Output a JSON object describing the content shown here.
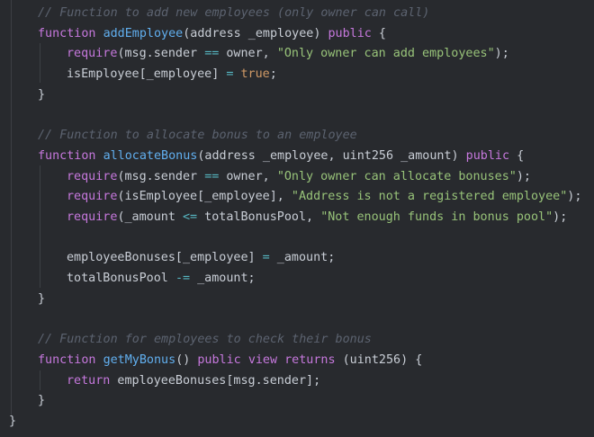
{
  "theme": {
    "background": "#282a2e",
    "text": "#c9ced6",
    "keyword": "#c678dd",
    "function": "#61afef",
    "string": "#98c379",
    "comment": "#5c6370",
    "boolean": "#d19a66",
    "operator": "#56b6c2"
  },
  "code": {
    "lines": [
      [
        {
          "t": "comment",
          "v": "// Function to add new employees (only owner can call)"
        }
      ],
      [
        {
          "t": "keyword",
          "v": "function"
        },
        {
          "t": "ident",
          "v": " "
        },
        {
          "t": "func",
          "v": "addEmployee"
        },
        {
          "t": "ident",
          "v": "(address _employee) "
        },
        {
          "t": "keyword",
          "v": "public"
        },
        {
          "t": "ident",
          "v": " {"
        }
      ],
      [
        {
          "t": "keyword",
          "v": "require"
        },
        {
          "t": "ident",
          "v": "(msg.sender "
        },
        {
          "t": "op",
          "v": "=="
        },
        {
          "t": "ident",
          "v": " owner, "
        },
        {
          "t": "string",
          "v": "\"Only owner can add employees\""
        },
        {
          "t": "ident",
          "v": ");"
        }
      ],
      [
        {
          "t": "ident",
          "v": "isEmployee[_employee] "
        },
        {
          "t": "op",
          "v": "="
        },
        {
          "t": "ident",
          "v": " "
        },
        {
          "t": "bool",
          "v": "true"
        },
        {
          "t": "ident",
          "v": ";"
        }
      ],
      [
        {
          "t": "ident",
          "v": "}"
        }
      ],
      [],
      [
        {
          "t": "comment",
          "v": "// Function to allocate bonus to an employee"
        }
      ],
      [
        {
          "t": "keyword",
          "v": "function"
        },
        {
          "t": "ident",
          "v": " "
        },
        {
          "t": "func",
          "v": "allocateBonus"
        },
        {
          "t": "ident",
          "v": "(address _employee, uint256 _amount) "
        },
        {
          "t": "keyword",
          "v": "public"
        },
        {
          "t": "ident",
          "v": " {"
        }
      ],
      [
        {
          "t": "keyword",
          "v": "require"
        },
        {
          "t": "ident",
          "v": "(msg.sender "
        },
        {
          "t": "op",
          "v": "=="
        },
        {
          "t": "ident",
          "v": " owner, "
        },
        {
          "t": "string",
          "v": "\"Only owner can allocate bonuses\""
        },
        {
          "t": "ident",
          "v": ");"
        }
      ],
      [
        {
          "t": "keyword",
          "v": "require"
        },
        {
          "t": "ident",
          "v": "(isEmployee[_employee], "
        },
        {
          "t": "string",
          "v": "\"Address is not a registered employee\""
        },
        {
          "t": "ident",
          "v": ");"
        }
      ],
      [
        {
          "t": "keyword",
          "v": "require"
        },
        {
          "t": "ident",
          "v": "(_amount "
        },
        {
          "t": "op",
          "v": "<="
        },
        {
          "t": "ident",
          "v": " totalBonusPool, "
        },
        {
          "t": "string",
          "v": "\"Not enough funds in bonus pool\""
        },
        {
          "t": "ident",
          "v": ");"
        }
      ],
      [],
      [
        {
          "t": "ident",
          "v": "employeeBonuses[_employee] "
        },
        {
          "t": "op",
          "v": "="
        },
        {
          "t": "ident",
          "v": " _amount;"
        }
      ],
      [
        {
          "t": "ident",
          "v": "totalBonusPool "
        },
        {
          "t": "op",
          "v": "-="
        },
        {
          "t": "ident",
          "v": " _amount;"
        }
      ],
      [
        {
          "t": "ident",
          "v": "}"
        }
      ],
      [],
      [
        {
          "t": "comment",
          "v": "// Function for employees to check their bonus"
        }
      ],
      [
        {
          "t": "keyword",
          "v": "function"
        },
        {
          "t": "ident",
          "v": " "
        },
        {
          "t": "func",
          "v": "getMyBonus"
        },
        {
          "t": "ident",
          "v": "() "
        },
        {
          "t": "keyword",
          "v": "public"
        },
        {
          "t": "ident",
          "v": " "
        },
        {
          "t": "keyword",
          "v": "view"
        },
        {
          "t": "ident",
          "v": " "
        },
        {
          "t": "keyword",
          "v": "returns"
        },
        {
          "t": "ident",
          "v": " (uint256) {"
        }
      ],
      [
        {
          "t": "keyword",
          "v": "return"
        },
        {
          "t": "ident",
          "v": " employeeBonuses[msg.sender];"
        }
      ],
      [
        {
          "t": "ident",
          "v": "}"
        }
      ],
      [
        {
          "t": "ident",
          "v": "}"
        }
      ]
    ]
  }
}
